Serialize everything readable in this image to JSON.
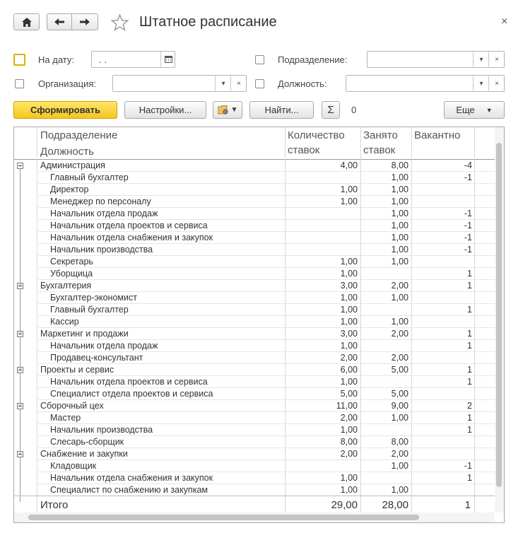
{
  "window": {
    "title": "Штатное расписание",
    "close_glyph": "×"
  },
  "toolbar_icons": {
    "home": "home-icon",
    "back": "arrow-left-icon",
    "forward": "arrow-right-icon",
    "favorite": "star-icon"
  },
  "filters": {
    "date_label": "На дату:",
    "date_value": " .  .",
    "subdivision_label": "Подразделение:",
    "subdivision_value": "",
    "organization_label": "Организация:",
    "organization_value": "",
    "position_label": "Должность:",
    "position_value": ""
  },
  "actions": {
    "generate": "Сформировать",
    "settings": "Настройки...",
    "find": "Найти...",
    "sum_glyph": "Σ",
    "sum_value": "0",
    "more": "Еще"
  },
  "table": {
    "headers": {
      "subdivision": "Подразделение",
      "position": "Должность",
      "count_line1": "Количество",
      "count_line2": "ставок",
      "occupied_line1": "Занято",
      "occupied_line2": "ставок",
      "vacant": "Вакантно"
    },
    "rows": [
      {
        "name": "Администрация",
        "level": 0,
        "count": "4,00",
        "occupied": "8,00",
        "vacant": "-4"
      },
      {
        "name": "Главный бухгалтер",
        "level": 1,
        "count": "",
        "occupied": "1,00",
        "vacant": "-1"
      },
      {
        "name": "Директор",
        "level": 1,
        "count": "1,00",
        "occupied": "1,00",
        "vacant": ""
      },
      {
        "name": "Менеджер по персоналу",
        "level": 1,
        "count": "1,00",
        "occupied": "1,00",
        "vacant": ""
      },
      {
        "name": "Начальник отдела продаж",
        "level": 1,
        "count": "",
        "occupied": "1,00",
        "vacant": "-1"
      },
      {
        "name": "Начальник отдела проектов и сервиса",
        "level": 1,
        "count": "",
        "occupied": "1,00",
        "vacant": "-1"
      },
      {
        "name": "Начальник отдела снабжения и закупок",
        "level": 1,
        "count": "",
        "occupied": "1,00",
        "vacant": "-1"
      },
      {
        "name": "Начальник производства",
        "level": 1,
        "count": "",
        "occupied": "1,00",
        "vacant": "-1"
      },
      {
        "name": "Секретарь",
        "level": 1,
        "count": "1,00",
        "occupied": "1,00",
        "vacant": ""
      },
      {
        "name": "Уборщица",
        "level": 1,
        "count": "1,00",
        "occupied": "",
        "vacant": "1"
      },
      {
        "name": "Бухгалтерия",
        "level": 0,
        "count": "3,00",
        "occupied": "2,00",
        "vacant": "1"
      },
      {
        "name": "Бухгалтер-экономист",
        "level": 1,
        "count": "1,00",
        "occupied": "1,00",
        "vacant": ""
      },
      {
        "name": "Главный бухгалтер",
        "level": 1,
        "count": "1,00",
        "occupied": "",
        "vacant": "1"
      },
      {
        "name": "Кассир",
        "level": 1,
        "count": "1,00",
        "occupied": "1,00",
        "vacant": ""
      },
      {
        "name": "Маркетинг и продажи",
        "level": 0,
        "count": "3,00",
        "occupied": "2,00",
        "vacant": "1"
      },
      {
        "name": "Начальник отдела продаж",
        "level": 1,
        "count": "1,00",
        "occupied": "",
        "vacant": "1"
      },
      {
        "name": "Продавец-консультант",
        "level": 1,
        "count": "2,00",
        "occupied": "2,00",
        "vacant": ""
      },
      {
        "name": "Проекты и сервис",
        "level": 0,
        "count": "6,00",
        "occupied": "5,00",
        "vacant": "1"
      },
      {
        "name": "Начальник отдела проектов и сервиса",
        "level": 1,
        "count": "1,00",
        "occupied": "",
        "vacant": "1"
      },
      {
        "name": "Специалист отдела проектов и сервиса",
        "level": 1,
        "count": "5,00",
        "occupied": "5,00",
        "vacant": ""
      },
      {
        "name": "Сборочный цех",
        "level": 0,
        "count": "11,00",
        "occupied": "9,00",
        "vacant": "2"
      },
      {
        "name": "Мастер",
        "level": 1,
        "count": "2,00",
        "occupied": "1,00",
        "vacant": "1"
      },
      {
        "name": "Начальник производства",
        "level": 1,
        "count": "1,00",
        "occupied": "",
        "vacant": "1"
      },
      {
        "name": "Слесарь-сборщик",
        "level": 1,
        "count": "8,00",
        "occupied": "8,00",
        "vacant": ""
      },
      {
        "name": "Снабжение и закупки",
        "level": 0,
        "count": "2,00",
        "occupied": "2,00",
        "vacant": ""
      },
      {
        "name": "Кладовщик",
        "level": 1,
        "count": "",
        "occupied": "1,00",
        "vacant": "-1"
      },
      {
        "name": "Начальник отдела снабжения и закупок",
        "level": 1,
        "count": "1,00",
        "occupied": "",
        "vacant": "1"
      },
      {
        "name": "Специалист по снабжению и закупкам",
        "level": 1,
        "count": "1,00",
        "occupied": "1,00",
        "vacant": ""
      }
    ],
    "totals": {
      "label": "Итого",
      "count": "29,00",
      "occupied": "28,00",
      "vacant": "1"
    }
  },
  "colors": {
    "primary_button": "#f5c51f",
    "border": "#a9a9a9",
    "text": "#333333"
  }
}
